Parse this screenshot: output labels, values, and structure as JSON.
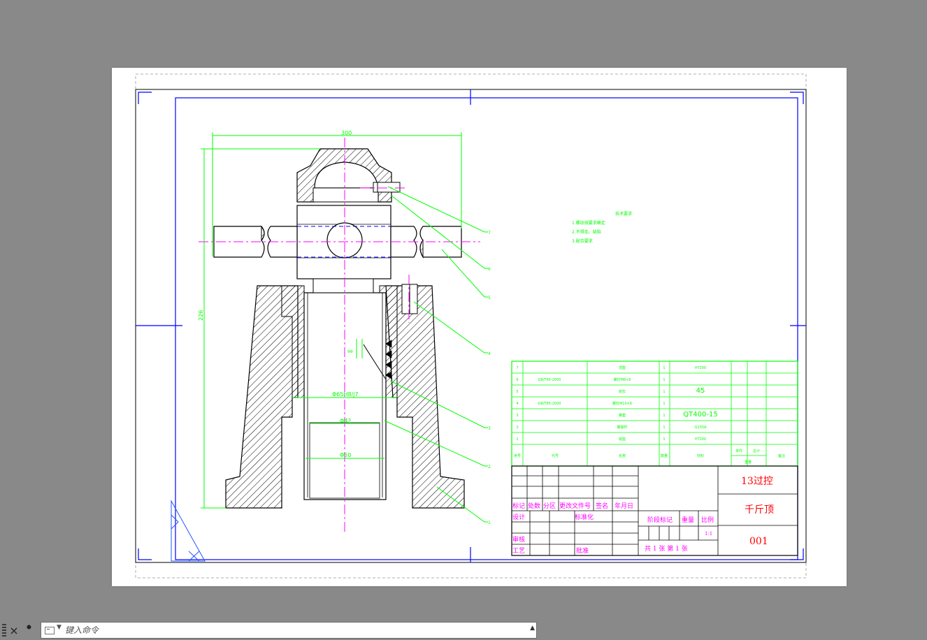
{
  "colors": {
    "app_background": "#898989",
    "paper": "#ffffff",
    "frame": "#0000ff",
    "geometry": "#000000",
    "dimension": "#00ff00",
    "centerline": "#ff00ff",
    "title_text": "#ff0000",
    "label_text": "#ff00ff"
  },
  "drawing": {
    "dims": {
      "width_300": "300",
      "height_226": "226",
      "fit": "Φ65H8/j7",
      "bore_42": "Φ42",
      "bore_50": "Φ50",
      "small": "ΦΦ"
    },
    "balloons": [
      "7",
      "6",
      "5",
      "4",
      "3",
      "2",
      "1"
    ],
    "notes": {
      "title": "技术要求",
      "lines": [
        "1.螺纹按要求确定",
        "2.不得毛、缺陷",
        "3.配合要求"
      ]
    }
  },
  "bom": {
    "rows": [
      {
        "seq": "7",
        "code": "",
        "name": "顶垫",
        "qty": "1",
        "material": "HT200"
      },
      {
        "seq": "6",
        "code": "GB/T65-2000",
        "name": "螺钉M8×6",
        "qty": "1",
        "material": ""
      },
      {
        "seq": "5",
        "code": "",
        "name": "绞杠",
        "qty": "1",
        "material": "45"
      },
      {
        "seq": "4",
        "code": "GB/T65-2000",
        "name": "螺钉M10×6",
        "qty": "1",
        "material": ""
      },
      {
        "seq": "3",
        "code": "",
        "name": "螺套",
        "qty": "1",
        "material": "QT400-15"
      },
      {
        "seq": "2",
        "code": "",
        "name": "螺旋杆",
        "qty": "1",
        "material": "Q235A"
      },
      {
        "seq": "1",
        "code": "",
        "name": "底座",
        "qty": "1",
        "material": "HT200"
      }
    ],
    "header": {
      "seq": "序号",
      "code": "代号",
      "name": "名称",
      "qty": "数量",
      "material": "材料",
      "single": "单件",
      "total": "总计",
      "weight": "重量",
      "note": "备注"
    }
  },
  "title_block": {
    "labels": {
      "mark": "标记",
      "count": "处数",
      "zone": "分区",
      "doc": "更改文件号",
      "sign": "签名",
      "date": "年月日",
      "design": "设计",
      "standard": "标准化",
      "review": "审核",
      "process": "工艺",
      "approve": "批准",
      "stage": "阶段标记",
      "weight": "重量",
      "scale": "比例",
      "sheets": "共 1  张  第 1 张"
    },
    "scale_value": "1:1",
    "unit": "13过控",
    "name": "千斤顶",
    "number": "001"
  },
  "command_line": {
    "placeholder": "键入命令",
    "close_icon": "×",
    "customize_icon": "wrench-icon",
    "history_icon": "▲"
  }
}
